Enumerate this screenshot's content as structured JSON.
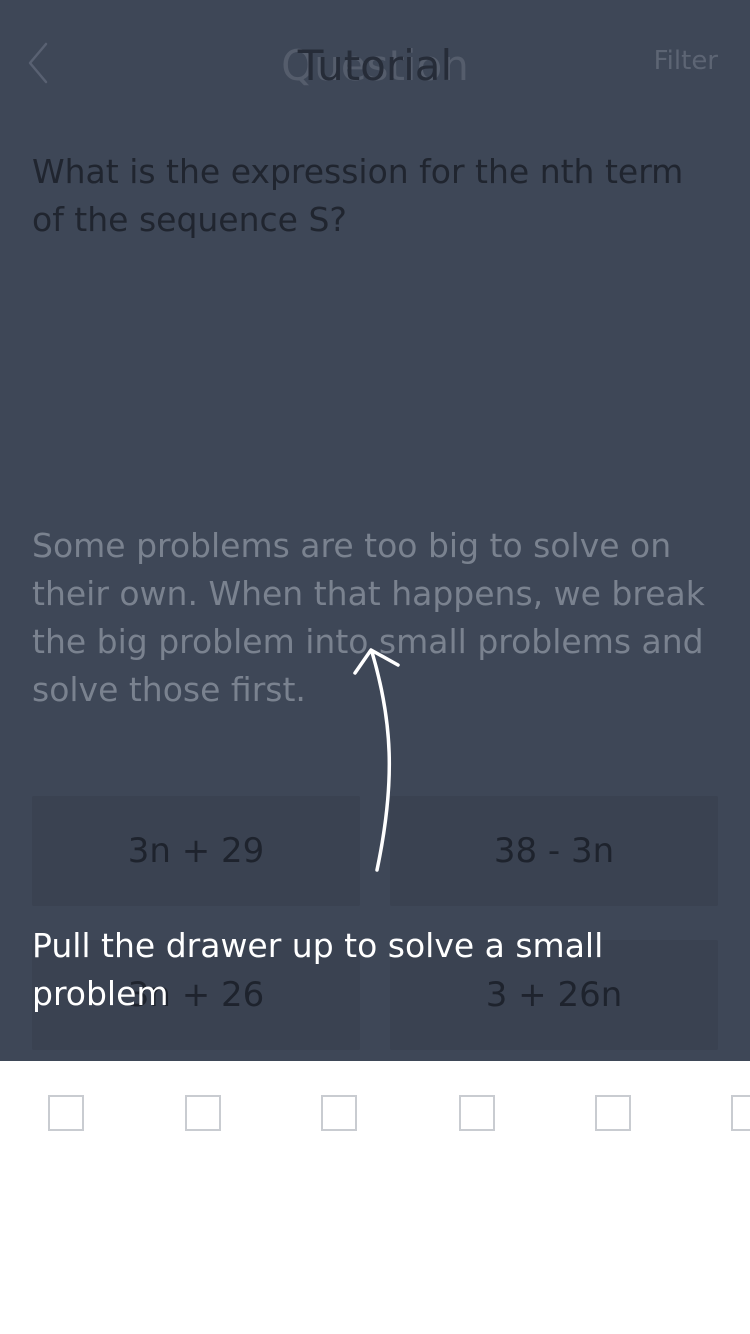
{
  "header": {
    "title_back": "Question",
    "title_front": "Tutorial",
    "filter_label": "Filter"
  },
  "question": {
    "text": "What is the expression for the nth term of the sequence S?"
  },
  "tutorial": {
    "body": "Some problems are too big to solve on their own. When that happens, we break the big problem into small problems and solve those first.",
    "hint": "Pull the drawer up to solve a small problem"
  },
  "answers": [
    {
      "label": "3n + 29"
    },
    {
      "label": "38 - 3n"
    },
    {
      "label": "3n + 26"
    },
    {
      "label": "3 + 26n"
    }
  ],
  "drawer": {
    "slot_count": 6
  },
  "icons": {
    "back": "chevron-left-icon",
    "arrow": "curved-up-arrow-icon"
  },
  "colors": {
    "overlay": "#3e4757",
    "drawer": "#ffffff",
    "hint_text": "#ffffff"
  }
}
